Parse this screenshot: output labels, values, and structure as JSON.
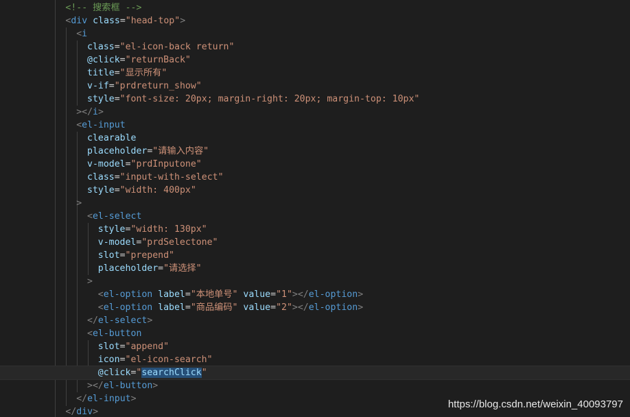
{
  "code_lines": [
    {
      "indent": 6,
      "tokens": [
        {
          "t": "<!-- 搜索框 -->",
          "c": "comment"
        }
      ]
    },
    {
      "indent": 6,
      "tokens": [
        {
          "t": "<",
          "c": "punct"
        },
        {
          "t": "div",
          "c": "tag"
        },
        {
          "t": " ",
          "c": "text"
        },
        {
          "t": "class",
          "c": "attr"
        },
        {
          "t": "=",
          "c": "text"
        },
        {
          "t": "\"head-top\"",
          "c": "str"
        },
        {
          "t": ">",
          "c": "punct"
        }
      ]
    },
    {
      "indent": 8,
      "tokens": [
        {
          "t": "<",
          "c": "punct"
        },
        {
          "t": "i",
          "c": "tag"
        }
      ]
    },
    {
      "indent": 10,
      "tokens": [
        {
          "t": "class",
          "c": "attr"
        },
        {
          "t": "=",
          "c": "text"
        },
        {
          "t": "\"el-icon-back return\"",
          "c": "str"
        }
      ]
    },
    {
      "indent": 10,
      "tokens": [
        {
          "t": "@click",
          "c": "attr"
        },
        {
          "t": "=",
          "c": "text"
        },
        {
          "t": "\"returnBack\"",
          "c": "str"
        }
      ]
    },
    {
      "indent": 10,
      "tokens": [
        {
          "t": "title",
          "c": "attr"
        },
        {
          "t": "=",
          "c": "text"
        },
        {
          "t": "\"显示所有\"",
          "c": "str"
        }
      ]
    },
    {
      "indent": 10,
      "tokens": [
        {
          "t": "v-if",
          "c": "attr"
        },
        {
          "t": "=",
          "c": "text"
        },
        {
          "t": "\"prdreturn_show\"",
          "c": "str"
        }
      ]
    },
    {
      "indent": 10,
      "tokens": [
        {
          "t": "style",
          "c": "attr"
        },
        {
          "t": "=",
          "c": "text"
        },
        {
          "t": "\"font-size: 20px; margin-right: 20px; margin-top: 10px\"",
          "c": "str"
        }
      ]
    },
    {
      "indent": 8,
      "tokens": [
        {
          "t": "></",
          "c": "punct"
        },
        {
          "t": "i",
          "c": "tag"
        },
        {
          "t": ">",
          "c": "punct"
        }
      ]
    },
    {
      "indent": 8,
      "tokens": [
        {
          "t": "<",
          "c": "punct"
        },
        {
          "t": "el-input",
          "c": "tag"
        }
      ]
    },
    {
      "indent": 10,
      "tokens": [
        {
          "t": "clearable",
          "c": "attr"
        }
      ]
    },
    {
      "indent": 10,
      "tokens": [
        {
          "t": "placeholder",
          "c": "attr"
        },
        {
          "t": "=",
          "c": "text"
        },
        {
          "t": "\"请输入内容\"",
          "c": "str"
        }
      ]
    },
    {
      "indent": 10,
      "tokens": [
        {
          "t": "v-model",
          "c": "attr"
        },
        {
          "t": "=",
          "c": "text"
        },
        {
          "t": "\"prdInputone\"",
          "c": "str"
        }
      ]
    },
    {
      "indent": 10,
      "tokens": [
        {
          "t": "class",
          "c": "attr"
        },
        {
          "t": "=",
          "c": "text"
        },
        {
          "t": "\"input-with-select\"",
          "c": "str"
        }
      ]
    },
    {
      "indent": 10,
      "tokens": [
        {
          "t": "style",
          "c": "attr"
        },
        {
          "t": "=",
          "c": "text"
        },
        {
          "t": "\"width: 400px\"",
          "c": "str"
        }
      ]
    },
    {
      "indent": 8,
      "tokens": [
        {
          "t": ">",
          "c": "punct"
        }
      ]
    },
    {
      "indent": 10,
      "tokens": [
        {
          "t": "<",
          "c": "punct"
        },
        {
          "t": "el-select",
          "c": "tag"
        }
      ]
    },
    {
      "indent": 12,
      "tokens": [
        {
          "t": "style",
          "c": "attr"
        },
        {
          "t": "=",
          "c": "text"
        },
        {
          "t": "\"width: 130px\"",
          "c": "str"
        }
      ]
    },
    {
      "indent": 12,
      "tokens": [
        {
          "t": "v-model",
          "c": "attr"
        },
        {
          "t": "=",
          "c": "text"
        },
        {
          "t": "\"prdSelectone\"",
          "c": "str"
        }
      ]
    },
    {
      "indent": 12,
      "tokens": [
        {
          "t": "slot",
          "c": "attr"
        },
        {
          "t": "=",
          "c": "text"
        },
        {
          "t": "\"prepend\"",
          "c": "str"
        }
      ]
    },
    {
      "indent": 12,
      "tokens": [
        {
          "t": "placeholder",
          "c": "attr"
        },
        {
          "t": "=",
          "c": "text"
        },
        {
          "t": "\"请选择\"",
          "c": "str"
        }
      ]
    },
    {
      "indent": 10,
      "tokens": [
        {
          "t": ">",
          "c": "punct"
        }
      ]
    },
    {
      "indent": 12,
      "tokens": [
        {
          "t": "<",
          "c": "punct"
        },
        {
          "t": "el-option",
          "c": "tag"
        },
        {
          "t": " ",
          "c": "text"
        },
        {
          "t": "label",
          "c": "attr"
        },
        {
          "t": "=",
          "c": "text"
        },
        {
          "t": "\"本地单号\"",
          "c": "str"
        },
        {
          "t": " ",
          "c": "text"
        },
        {
          "t": "value",
          "c": "attr"
        },
        {
          "t": "=",
          "c": "text"
        },
        {
          "t": "\"1\"",
          "c": "str"
        },
        {
          "t": "></",
          "c": "punct"
        },
        {
          "t": "el-option",
          "c": "tag"
        },
        {
          "t": ">",
          "c": "punct"
        }
      ]
    },
    {
      "indent": 12,
      "tokens": [
        {
          "t": "<",
          "c": "punct"
        },
        {
          "t": "el-option",
          "c": "tag"
        },
        {
          "t": " ",
          "c": "text"
        },
        {
          "t": "label",
          "c": "attr"
        },
        {
          "t": "=",
          "c": "text"
        },
        {
          "t": "\"商品编码\"",
          "c": "str"
        },
        {
          "t": " ",
          "c": "text"
        },
        {
          "t": "value",
          "c": "attr"
        },
        {
          "t": "=",
          "c": "text"
        },
        {
          "t": "\"2\"",
          "c": "str"
        },
        {
          "t": "></",
          "c": "punct"
        },
        {
          "t": "el-option",
          "c": "tag"
        },
        {
          "t": ">",
          "c": "punct"
        }
      ]
    },
    {
      "indent": 10,
      "tokens": [
        {
          "t": "</",
          "c": "punct"
        },
        {
          "t": "el-select",
          "c": "tag"
        },
        {
          "t": ">",
          "c": "punct"
        }
      ]
    },
    {
      "indent": 10,
      "tokens": [
        {
          "t": "<",
          "c": "punct"
        },
        {
          "t": "el-button",
          "c": "tag"
        }
      ]
    },
    {
      "indent": 12,
      "tokens": [
        {
          "t": "slot",
          "c": "attr"
        },
        {
          "t": "=",
          "c": "text"
        },
        {
          "t": "\"append\"",
          "c": "str"
        }
      ]
    },
    {
      "indent": 12,
      "tokens": [
        {
          "t": "icon",
          "c": "attr"
        },
        {
          "t": "=",
          "c": "text"
        },
        {
          "t": "\"el-icon-search\"",
          "c": "str"
        }
      ]
    },
    {
      "indent": 12,
      "active": true,
      "tokens": [
        {
          "t": "@click",
          "c": "attr"
        },
        {
          "t": "=",
          "c": "text"
        },
        {
          "t": "\"",
          "c": "str"
        },
        {
          "t": "searchClick",
          "c": "sel"
        },
        {
          "t": "\"",
          "c": "str"
        }
      ]
    },
    {
      "indent": 10,
      "tokens": [
        {
          "t": "></",
          "c": "punct"
        },
        {
          "t": "el-button",
          "c": "tag"
        },
        {
          "t": ">",
          "c": "punct"
        }
      ]
    },
    {
      "indent": 8,
      "tokens": [
        {
          "t": "</",
          "c": "punct"
        },
        {
          "t": "el-input",
          "c": "tag"
        },
        {
          "t": ">",
          "c": "punct"
        }
      ]
    },
    {
      "indent": 6,
      "tokens": [
        {
          "t": "</",
          "c": "punct"
        },
        {
          "t": "div",
          "c": "tag"
        },
        {
          "t": ">",
          "c": "punct"
        }
      ]
    }
  ],
  "watermark": "https://blog.csdn.net/weixin_40093797"
}
